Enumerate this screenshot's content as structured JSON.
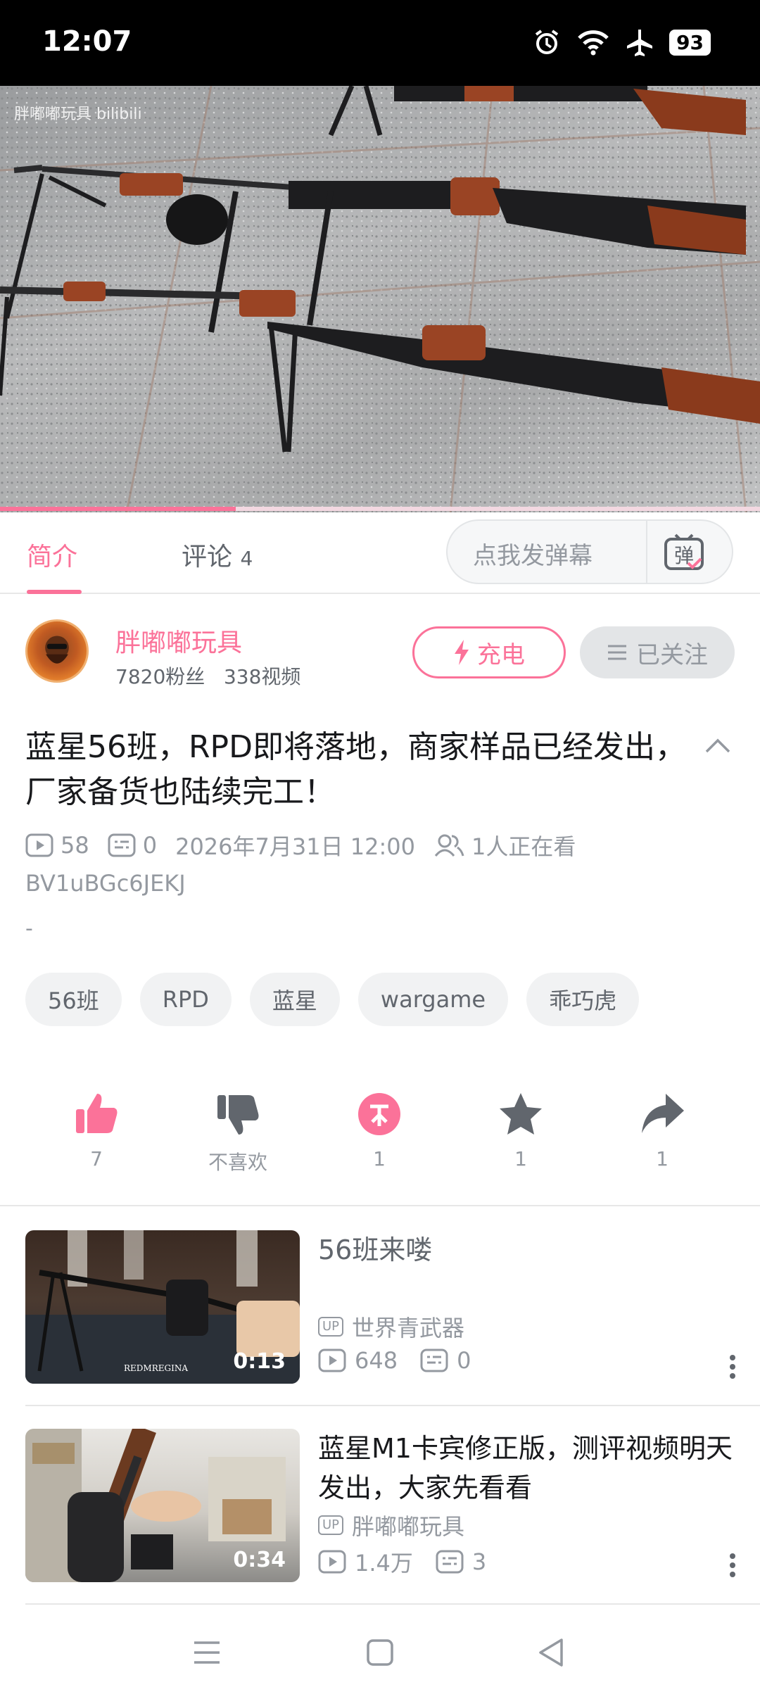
{
  "status_bar": {
    "time": "12:07",
    "battery": "93",
    "icons": [
      "alarm-icon",
      "wifi-icon",
      "airplane-icon",
      "battery-icon"
    ]
  },
  "video": {
    "watermark": "胖嘟嘟玩具 bilibili",
    "progress_fraction": 0.31
  },
  "tabs": {
    "intro": "简介",
    "comments": "评论",
    "comments_count": "4",
    "danmaku_placeholder": "点我发弹幕",
    "danmaku_icon_label": "弹"
  },
  "uploader": {
    "name": "胖嘟嘟玩具",
    "fans": "7820粉丝",
    "videos": "338视频",
    "charge_label": "充电",
    "follow_label": "已关注"
  },
  "video_info": {
    "title": "蓝星56班，RPD即将落地，商家样品已经发出，厂家备货也陆续完工！",
    "plays": "58",
    "danmaku": "0",
    "date": "2026年7月31日 12:00",
    "watching": "1人正在看",
    "bvid": "BV1uBGc6JEKJ",
    "desc": "-"
  },
  "tags": [
    "56班",
    "RPD",
    "蓝星",
    "wargame",
    "乖巧虎"
  ],
  "actions": [
    {
      "icon": "like-icon",
      "label": "7"
    },
    {
      "icon": "dislike-icon",
      "label": "不喜欢"
    },
    {
      "icon": "coin-icon",
      "label": "1"
    },
    {
      "icon": "favorite-icon",
      "label": "1"
    },
    {
      "icon": "share-icon",
      "label": "1"
    }
  ],
  "related": [
    {
      "title": "56班来喽",
      "up": "世界青武器",
      "plays": "648",
      "danmaku": "0",
      "duration": "0:13",
      "thumb_text": "REDMREGINA"
    },
    {
      "title": "蓝星M1卡宾修正版，测评视频明天发出，大家先看看",
      "up": "胖嘟嘟玩具",
      "plays": "1.4万",
      "danmaku": "3",
      "duration": "0:34"
    }
  ],
  "colors": {
    "accent": "#fb7299",
    "text": "#18191c",
    "secondary": "#9499a0"
  }
}
